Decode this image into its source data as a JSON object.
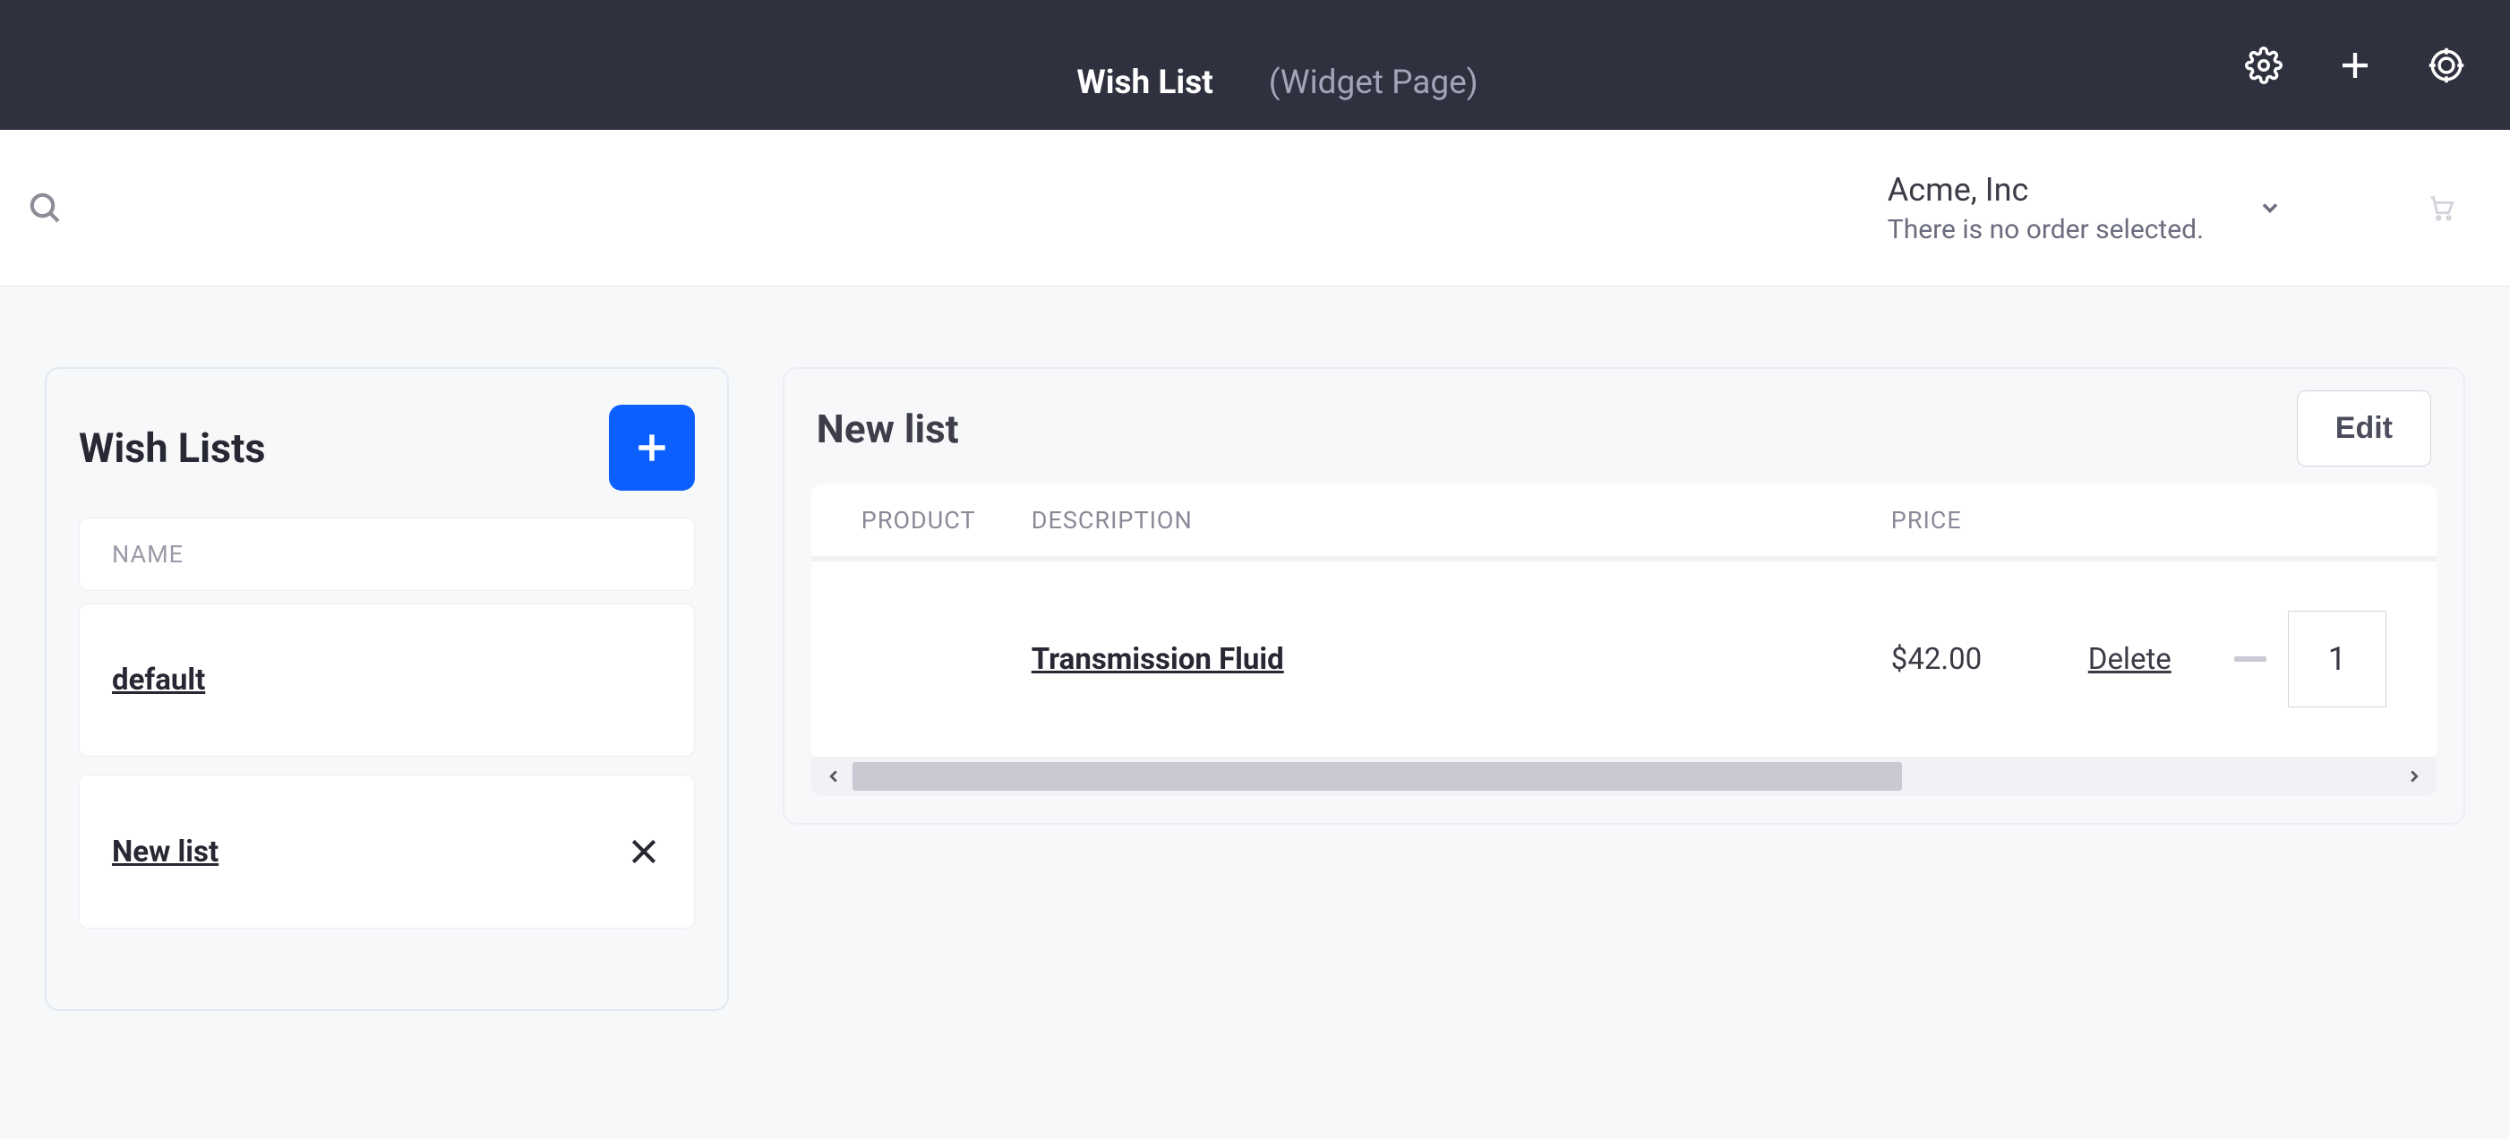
{
  "topbar": {
    "title_main": "Wish List",
    "title_sub": "(Widget Page)"
  },
  "subheader": {
    "account_name": "Acme, Inc",
    "account_sub": "There is no order selected."
  },
  "sidebar": {
    "title": "Wish Lists",
    "column_name": "NAME",
    "items": [
      {
        "label": "default",
        "removable": false
      },
      {
        "label": "New list",
        "removable": true
      }
    ]
  },
  "detail": {
    "title": "New list",
    "edit_label": "Edit",
    "columns": {
      "product": "PRODUCT",
      "description": "DESCRIPTION",
      "price": "PRICE"
    },
    "rows": [
      {
        "product_name": "Transmission Fluid",
        "price": "$42.00",
        "delete_label": "Delete",
        "quantity": "1"
      }
    ]
  }
}
